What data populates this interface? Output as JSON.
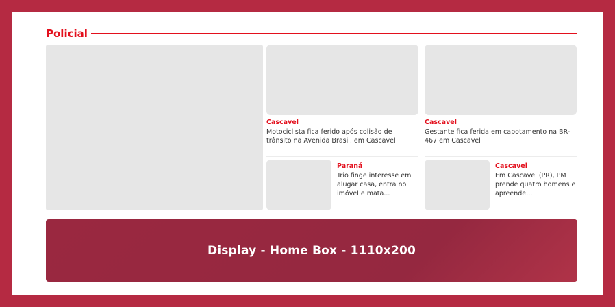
{
  "section": {
    "title": "Policial"
  },
  "cards": [
    {
      "category": "Cascavel",
      "title": "Motociclista fica ferido após colisão de trânsito na Avenida Brasil, em Cascavel"
    },
    {
      "category": "Cascavel",
      "title": "Gestante fica ferida em capotamento na BR-467 em Cascavel"
    },
    {
      "category": "Paraná",
      "title": "Trio finge interesse em alugar casa, entra no imóvel e mata..."
    },
    {
      "category": "Cascavel",
      "title": "Em Cascavel (PR), PM prende quatro homens e apreende..."
    }
  ],
  "banner": {
    "label": "Display - Home Box - 1110x200"
  },
  "colors": {
    "background": "#b52a42",
    "accent": "#e3101d",
    "banner": "#9a2840",
    "placeholder": "#e6e6e6"
  }
}
